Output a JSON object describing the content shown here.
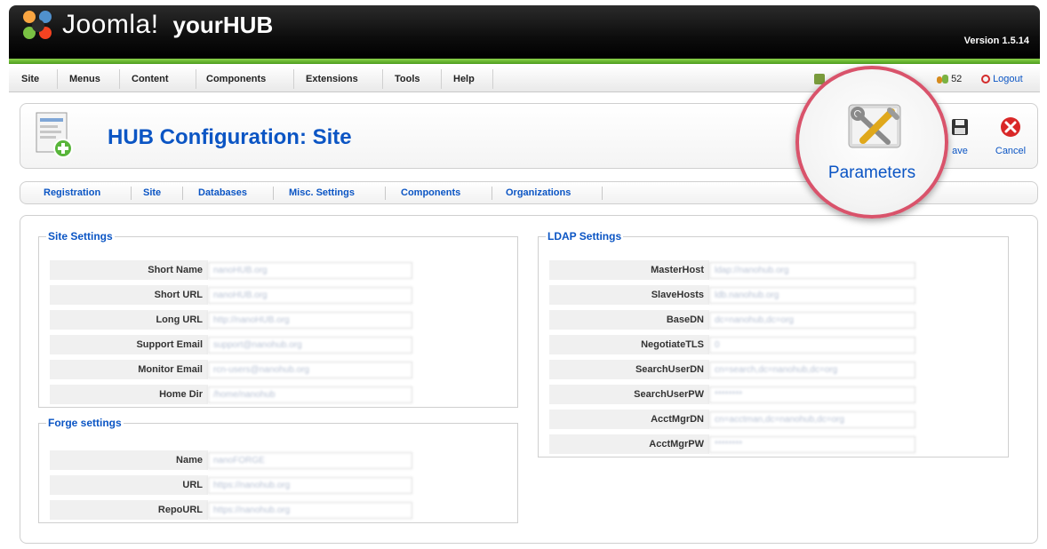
{
  "header": {
    "brand": "Joomla!",
    "site_name": "yourHUB",
    "version": "Version 1.5.14",
    "colors": {
      "bar": "#000000",
      "accent": "#6fc23a",
      "link": "#0b55c4"
    }
  },
  "menubar": {
    "items": [
      "Site",
      "Menus",
      "Content",
      "Components",
      "Extensions",
      "Tools",
      "Help"
    ],
    "status": {
      "users": "52",
      "logout": "Logout"
    }
  },
  "toolbar": {
    "title": "HUB Configuration: Site",
    "buttons": {
      "parameters": "Parameters",
      "save": "ave",
      "cancel": "Cancel"
    }
  },
  "tabs": [
    "Registration",
    "Site",
    "Databases",
    "Misc. Settings",
    "Components",
    "Organizations"
  ],
  "site_settings": {
    "legend": "Site Settings",
    "fields": [
      {
        "label": "Short Name",
        "value": "nanoHUB.org"
      },
      {
        "label": "Short URL",
        "value": "nanoHUB.org"
      },
      {
        "label": "Long URL",
        "value": "http://nanoHUB.org"
      },
      {
        "label": "Support Email",
        "value": "support@nanohub.org"
      },
      {
        "label": "Monitor Email",
        "value": "rcn-users@nanohub.org"
      },
      {
        "label": "Home Dir",
        "value": "/home/nanohub"
      }
    ]
  },
  "forge_settings": {
    "legend": "Forge settings",
    "fields": [
      {
        "label": "Name",
        "value": "nanoFORGE"
      },
      {
        "label": "URL",
        "value": "https://nanohub.org"
      },
      {
        "label": "RepoURL",
        "value": "https://nanohub.org"
      }
    ]
  },
  "ldap_settings": {
    "legend": "LDAP Settings",
    "fields": [
      {
        "label": "MasterHost",
        "value": "ldap://nanohub.org"
      },
      {
        "label": "SlaveHosts",
        "value": "ldb.nanohub.org"
      },
      {
        "label": "BaseDN",
        "value": "dc=nanohub,dc=org"
      },
      {
        "label": "NegotiateTLS",
        "value": "0"
      },
      {
        "label": "SearchUserDN",
        "value": "cn=search,dc=nanohub,dc=org"
      },
      {
        "label": "SearchUserPW",
        "value": "********"
      },
      {
        "label": "AcctMgrDN",
        "value": "cn=acctman,dc=nanohub,dc=org"
      },
      {
        "label": "AcctMgrPW",
        "value": "********"
      }
    ]
  }
}
